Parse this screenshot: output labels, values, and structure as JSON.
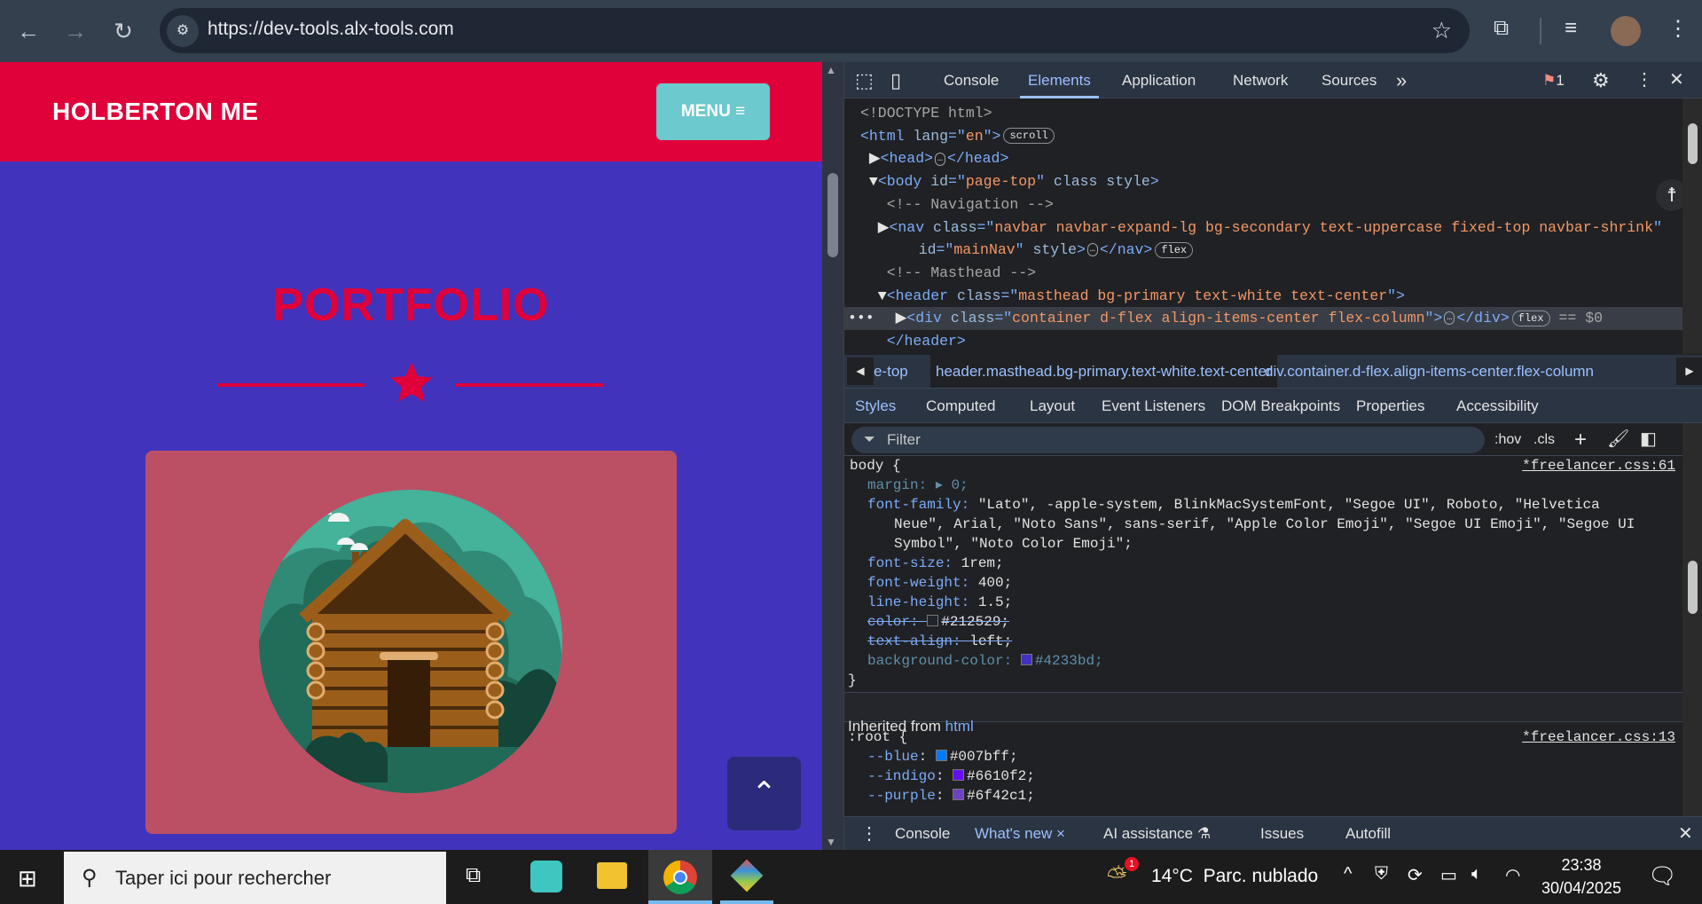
{
  "browser": {
    "url": "https://dev-tools.alx-tools.com",
    "icons": [
      "back-icon",
      "forward-icon",
      "reload-icon",
      "site-info-icon",
      "bookmark-star-icon",
      "extensions-icon",
      "media-icon",
      "profile-avatar",
      "more-icon"
    ]
  },
  "page": {
    "brand": "HOLBERTON ME",
    "menu_label": "MENU ≡",
    "heading": "PORTFOLIO",
    "colors": {
      "navbar": "#e0003a",
      "background": "#4233bd",
      "menu_button": "#6cc9cd",
      "card": "#bb5065",
      "scroll_top": "#2c2a7a"
    },
    "scroll_top_icon": "⌃"
  },
  "devtools": {
    "tabs": [
      "Console",
      "Elements",
      "Application",
      "Network",
      "Sources",
      "»"
    ],
    "active_tab": "Elements",
    "issues_count": "1",
    "dom_lines": [
      [
        [
          "cm",
          "<!DOCTYPE html>"
        ]
      ],
      [
        [
          "t",
          "<html "
        ],
        [
          "an",
          "lang"
        ],
        [
          "t",
          "=\""
        ],
        [
          "av",
          "en"
        ],
        [
          "t",
          "\">"
        ],
        [
          "badge",
          "scroll"
        ]
      ],
      [
        [
          "tx",
          " ▶"
        ],
        [
          "t",
          "<head>"
        ],
        [
          "ell",
          "…"
        ],
        [
          "t",
          "</head>"
        ]
      ],
      [
        [
          "tx",
          " ▼"
        ],
        [
          "t",
          "<body "
        ],
        [
          "an",
          "id"
        ],
        [
          "t",
          "=\""
        ],
        [
          "av",
          "page-top"
        ],
        [
          "t",
          "\" "
        ],
        [
          "an",
          "class style"
        ],
        [
          "t",
          ">"
        ]
      ],
      [
        [
          "cm",
          "   <!-- Navigation -->"
        ]
      ],
      [
        [
          "tx",
          "  ▶"
        ],
        [
          "t",
          "<nav "
        ],
        [
          "an",
          "class"
        ],
        [
          "t",
          "=\""
        ],
        [
          "av",
          "navbar navbar-expand-lg bg-secondary text-uppercase fixed-top navbar-shrink"
        ],
        [
          "t",
          "\""
        ]
      ],
      [
        [
          "tx",
          "   "
        ],
        [
          "an",
          "id"
        ],
        [
          "t",
          "=\""
        ],
        [
          "av",
          "mainNav"
        ],
        [
          "t",
          "\" "
        ],
        [
          "an",
          "style"
        ],
        [
          "t",
          ">"
        ],
        [
          "ell",
          "…"
        ],
        [
          "t",
          "</nav>"
        ],
        [
          "badge",
          "flex"
        ]
      ],
      [
        [
          "cm",
          "   <!-- Masthead -->"
        ]
      ],
      [
        [
          "tx",
          "  ▼"
        ],
        [
          "t",
          "<header "
        ],
        [
          "an",
          "class"
        ],
        [
          "t",
          "=\""
        ],
        [
          "av",
          "masthead bg-primary text-white text-center"
        ],
        [
          "t",
          "\">"
        ]
      ],
      [
        [
          "tx",
          "    ▶"
        ],
        [
          "t",
          "<div "
        ],
        [
          "an",
          "class"
        ],
        [
          "t",
          "=\""
        ],
        [
          "av",
          "container d-flex align-items-center flex-column"
        ],
        [
          "t",
          "\">"
        ],
        [
          "ell",
          "…"
        ],
        [
          "t",
          "</div>"
        ],
        [
          "badge",
          "flex"
        ],
        [
          "cm",
          " == $0"
        ]
      ],
      [
        [
          "t",
          "   </header>"
        ]
      ]
    ],
    "breadcrumbs": [
      "e-top",
      "header.masthead.bg-primary.text-white.text-center",
      "div.container.d-flex.align-items-center.flex-column"
    ],
    "subtabs": [
      "Styles",
      "Computed",
      "Layout",
      "Event Listeners",
      "DOM Breakpoints",
      "Properties",
      "Accessibility"
    ],
    "filter_placeholder": "Filter",
    "filter_tools": [
      ":hov",
      ".cls",
      "+"
    ],
    "styles": {
      "body_selector": "body {",
      "body_source": "*freelancer.css:61",
      "props": [
        {
          "name": "margin",
          "value": "▸ 0;",
          "dim": true
        },
        {
          "name": "font-family",
          "value": "\"Lato\", -apple-system, BlinkMacSystemFont, \"Segoe UI\", Roboto, \"Helvetica"
        },
        {
          "cont": "Neue\", Arial, \"Noto Sans\", sans-serif, \"Apple Color Emoji\", \"Segoe UI Emoji\", \"Segoe UI"
        },
        {
          "cont": "Symbol\", \"Noto Color Emoji\";"
        },
        {
          "name": "font-size",
          "value": "1rem;"
        },
        {
          "name": "font-weight",
          "value": "400;"
        },
        {
          "name": "line-height",
          "value": "1.5;"
        },
        {
          "name": "color",
          "value": "#212529;",
          "strike": true,
          "swatch": "#212529"
        },
        {
          "name": "text-align",
          "value": "left;",
          "strike": true
        },
        {
          "name": "background-color",
          "value": "#4233bd;",
          "dim": true,
          "swatch": "#4233bd"
        }
      ],
      "close": "}",
      "inherited_label": "Inherited from",
      "inherited_from": "html",
      "root_selector": ":root {",
      "root_source": "*freelancer.css:13",
      "root_props": [
        {
          "name": "--blue",
          "value": "#007bff;",
          "swatch": "#007bff"
        },
        {
          "name": "--indigo",
          "value": "#6610f2;",
          "swatch": "#6610f2"
        },
        {
          "name": "--purple",
          "value": "#6f42c1;",
          "swatch": "#6f42c1"
        }
      ]
    },
    "drawer_tabs": [
      "Console",
      "What's new ×",
      "AI assistance ⚗",
      "Issues",
      "Autofill"
    ]
  },
  "taskbar": {
    "search_placeholder": "Taper ici pour rechercher",
    "weather": "14°C  Parc. nublado",
    "time": "23:38",
    "date": "30/04/2025",
    "weather_badge": "1"
  }
}
